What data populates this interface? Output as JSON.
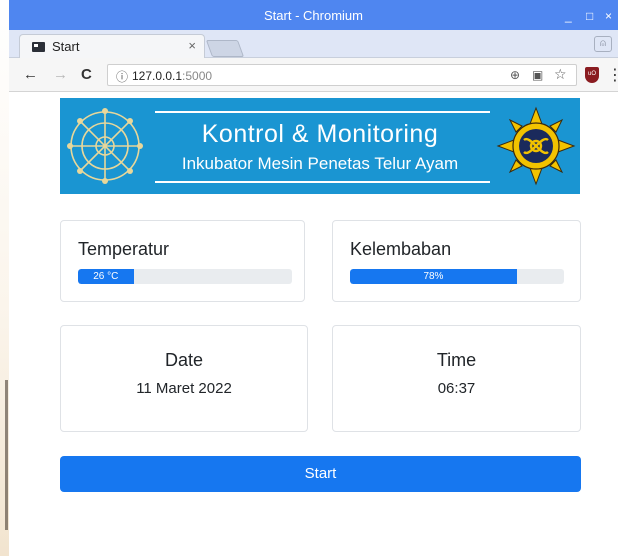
{
  "window": {
    "title": "Start - Chromium",
    "minimize": "_",
    "maximize": "□",
    "close": "×"
  },
  "tab": {
    "label": "Start",
    "close": "×"
  },
  "toolbar": {
    "back": "←",
    "forward": "→",
    "reload": "C",
    "info_icon": "ⓘ",
    "url_host": "127.0.0.1",
    "url_port": ":5000",
    "zoom_icon": "⊕",
    "translate_icon": "▣",
    "bookmark_icon": "☆",
    "extension_label": "uO",
    "menu_icon": "⋮"
  },
  "banner": {
    "title": "Kontrol & Monitoring",
    "subtitle": "Inkubator Mesin Penetas Telur Ayam",
    "color": "#1a95d2"
  },
  "temperature": {
    "heading": "Temperatur",
    "value_label": "26 °C",
    "percent": 26
  },
  "humidity": {
    "heading": "Kelembaban",
    "value_label": "78%",
    "percent": 78
  },
  "date": {
    "heading": "Date",
    "value": "11 Maret 2022"
  },
  "time": {
    "heading": "Time",
    "value": "06:37"
  },
  "start_button": {
    "label": "Start",
    "color": "#1677f0"
  }
}
